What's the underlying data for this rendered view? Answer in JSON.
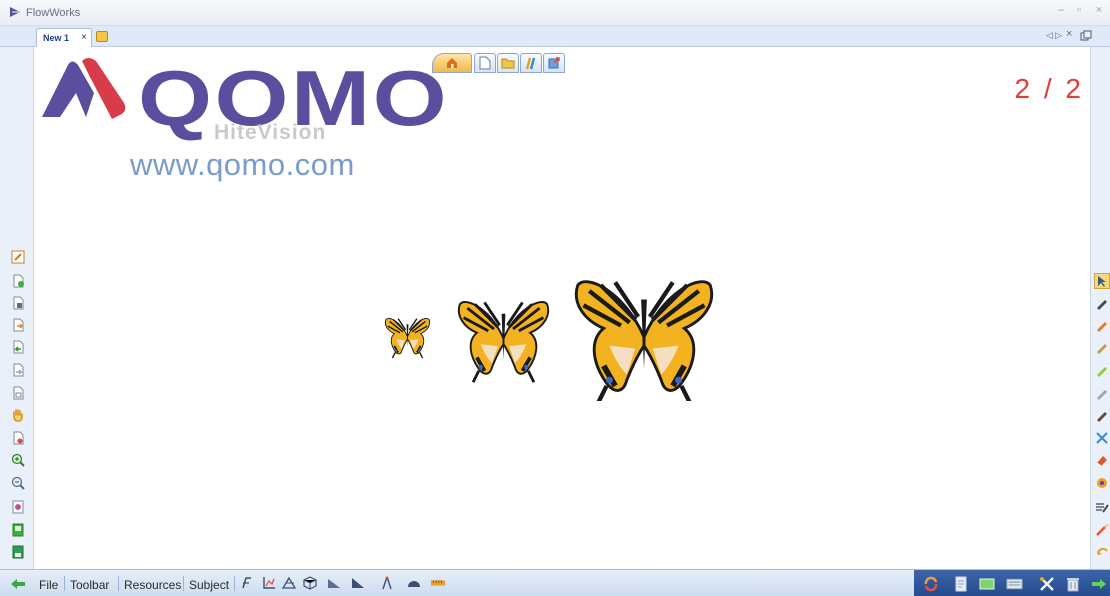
{
  "window": {
    "title": "FlowWorks",
    "min": "–",
    "max": "▫",
    "close": "×"
  },
  "tabs": [
    {
      "label": "New 1",
      "close": "×"
    }
  ],
  "tab_nav": {
    "prev": "◁",
    "next": "▷",
    "close": "×"
  },
  "logo": {
    "brand": "QOMO",
    "sub": "HiteVision",
    "url": "www.qomo.com"
  },
  "page_counter": "2 / 2",
  "bottom_menu": {
    "file": "File",
    "toolbar": "Toolbar",
    "resources": "Resources",
    "subject": "Subject"
  },
  "left_tools": [
    "edit-page-icon",
    "new-page-icon",
    "blank-page-icon",
    "import-page-icon",
    "previous-page-icon",
    "next-page-icon",
    "page-sorter-icon",
    "hand-pan-icon",
    "page-find-icon",
    "zoom-in-icon",
    "zoom-out-icon",
    "background-icon",
    "screenshot-icon",
    "save-icon"
  ],
  "right_tools": [
    "select-arrow-icon",
    "pen-icon",
    "brush-icon",
    "highlighter-icon",
    "laser-pen-icon",
    "soft-pen-icon",
    "calligraphy-pen-icon",
    "shape-recognition-icon",
    "eraser-icon",
    "fill-icon",
    "text-icon",
    "magic-pen-icon",
    "undo-icon"
  ],
  "page_toolbar": [
    "home-icon",
    "page-icon",
    "folder-icon",
    "pens-icon",
    "export-icon"
  ],
  "colors": {
    "accent": "#5a4f9e",
    "counter": "#e53b3b",
    "url": "#7b9cc8",
    "logo_red": "#d83b49"
  }
}
